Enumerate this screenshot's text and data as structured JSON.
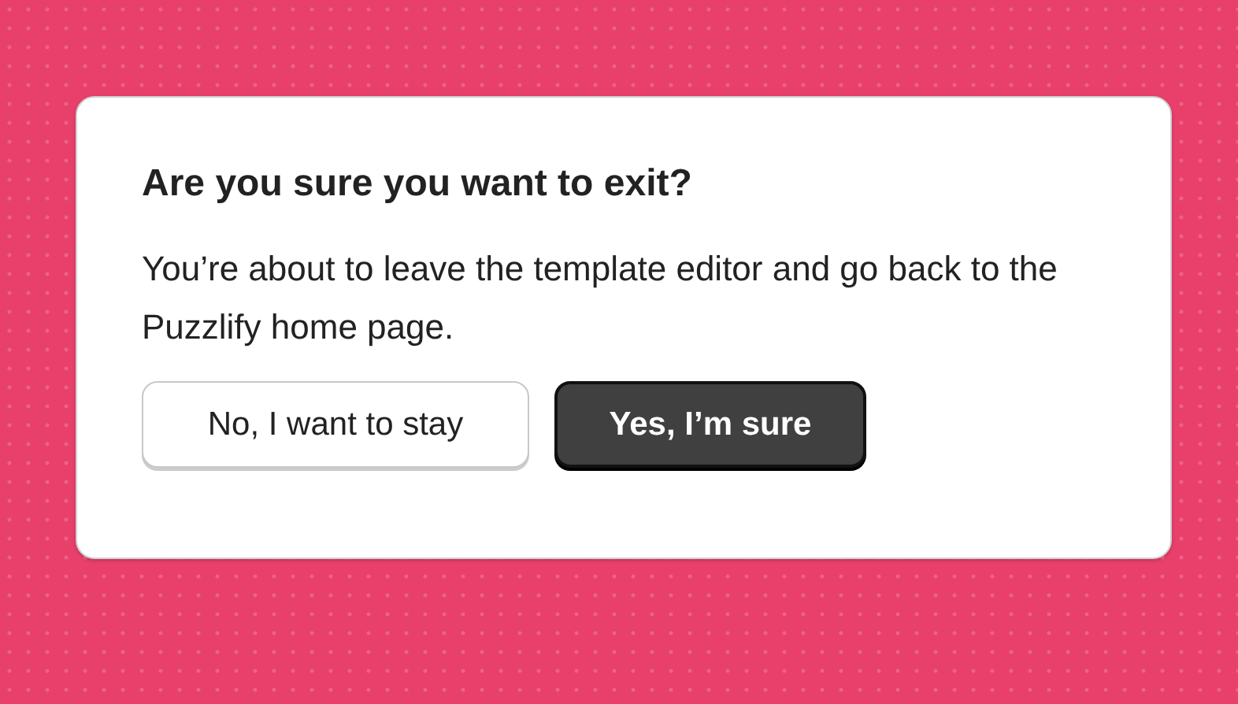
{
  "dialog": {
    "title": "Are you sure you want to exit?",
    "message": "You’re about to leave the template editor and go back to the Puzzlify home page.",
    "buttons": [
      {
        "label": "No, I want to stay",
        "kind": "secondary"
      },
      {
        "label": "Yes, I’m sure",
        "kind": "primary"
      }
    ]
  }
}
